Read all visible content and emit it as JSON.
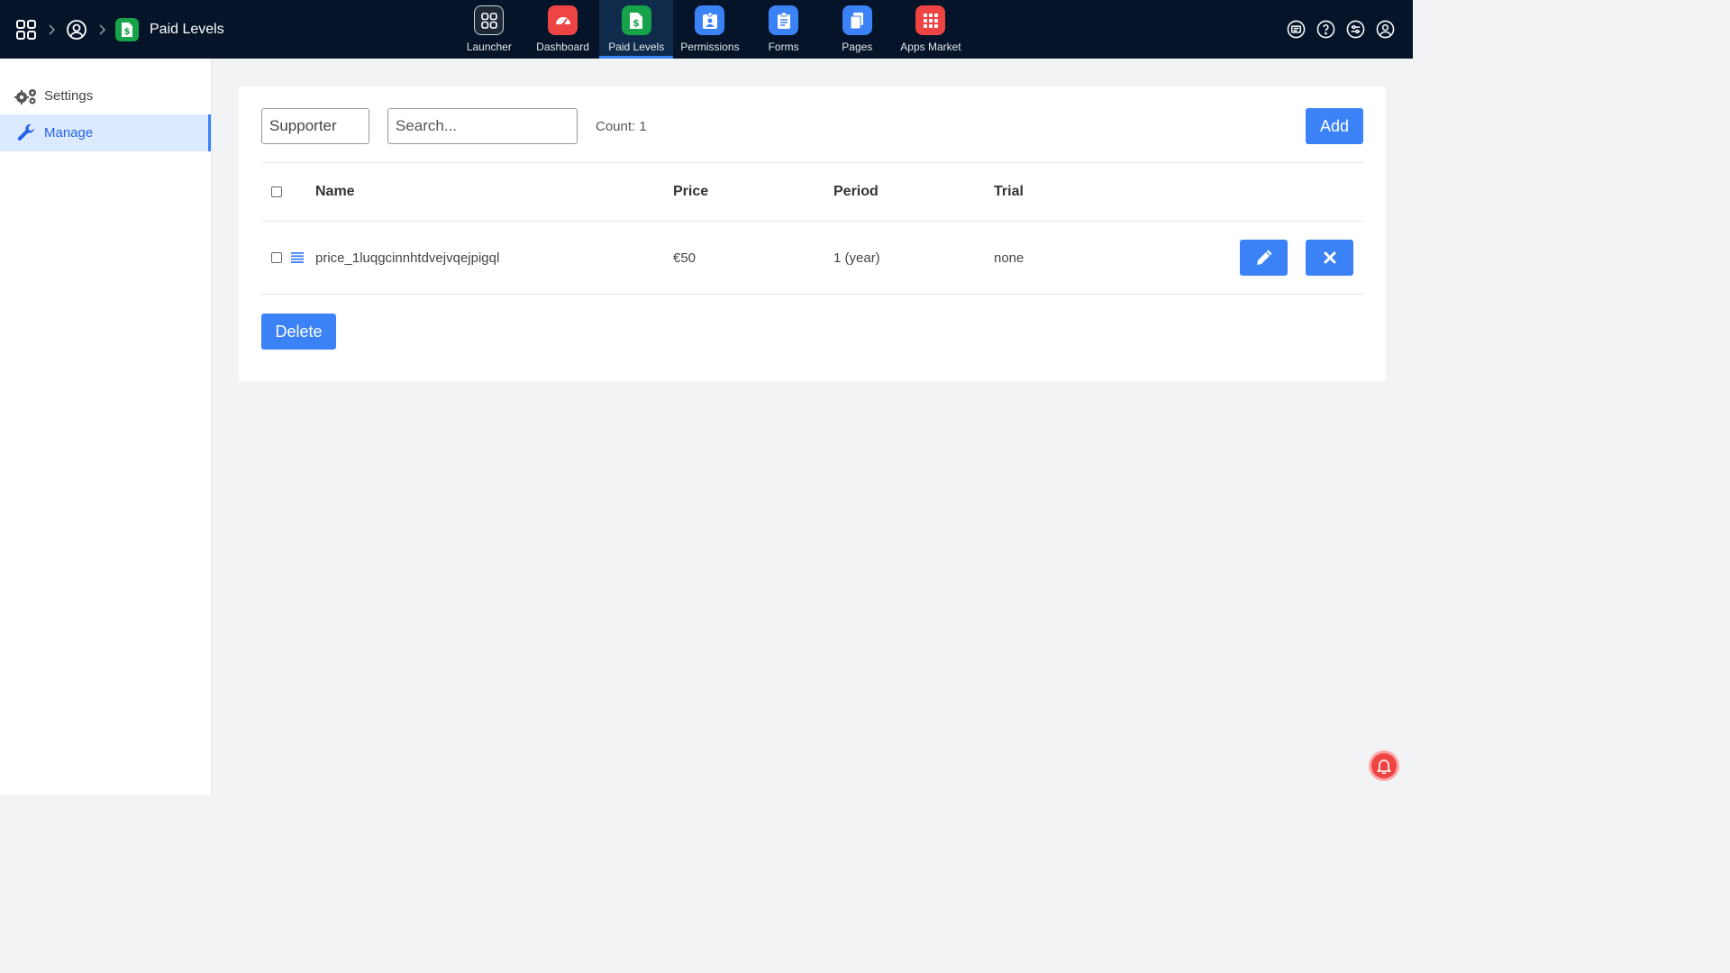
{
  "breadcrumb": {
    "app_title": "Paid Levels"
  },
  "appnav": {
    "items": [
      {
        "label": "Launcher",
        "icon": "grid-icon",
        "color": "#1f2937"
      },
      {
        "label": "Dashboard",
        "icon": "speedometer-icon",
        "color": "#ef4444"
      },
      {
        "label": "Paid Levels",
        "icon": "dollar-document-icon",
        "color": "#16a34a"
      },
      {
        "label": "Permissions",
        "icon": "id-badge-icon",
        "color": "#3b82f6"
      },
      {
        "label": "Forms",
        "icon": "clipboard-icon",
        "color": "#3b82f6"
      },
      {
        "label": "Pages",
        "icon": "pages-icon",
        "color": "#3b82f6"
      },
      {
        "label": "Apps Market",
        "icon": "apps-grid-icon",
        "color": "#ef4444"
      }
    ],
    "active": "Paid Levels"
  },
  "sidebar": {
    "items": [
      {
        "label": "Settings",
        "icon": "gears-icon"
      },
      {
        "label": "Manage",
        "icon": "wrench-icon"
      }
    ],
    "active": "Manage"
  },
  "toolbar": {
    "filter_value": "Supporter",
    "search_placeholder": "Search...",
    "count_text": "Count: 1",
    "add_label": "Add"
  },
  "table": {
    "headers": {
      "name": "Name",
      "price": "Price",
      "period": "Period",
      "trial": "Trial"
    },
    "rows": [
      {
        "name": "price_1luqgcinnhtdvejvqejpigql",
        "price": "€50",
        "period": "1 (year)",
        "trial": "none"
      }
    ]
  },
  "delete_label": "Delete",
  "colors": {
    "topbar": "#051429",
    "accent": "#3b82f6",
    "active_side": "#dbeafe"
  }
}
